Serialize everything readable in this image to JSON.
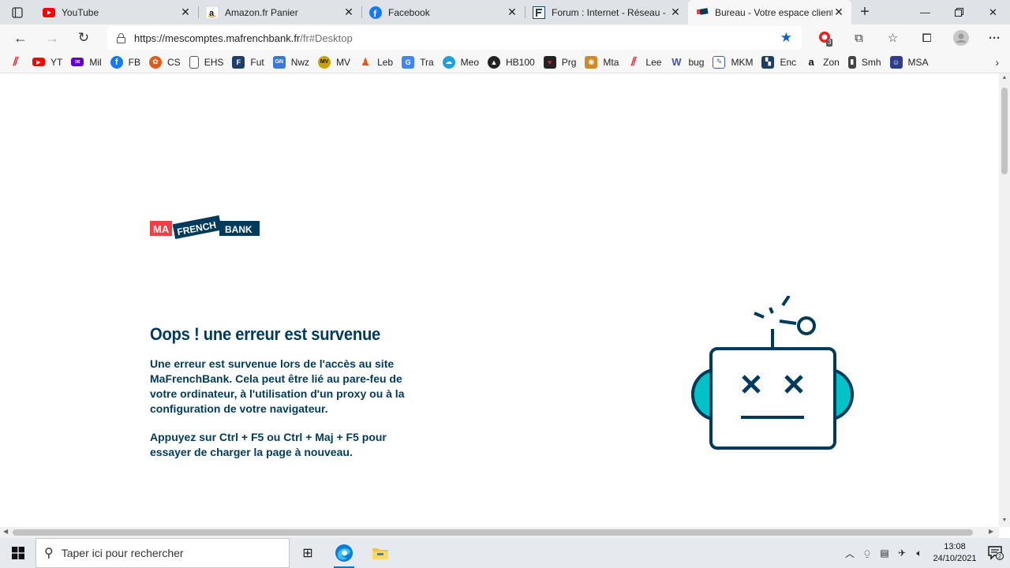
{
  "browser": {
    "tabs": [
      {
        "title": "YouTube",
        "icon": "youtube-icon",
        "active": false
      },
      {
        "title": "Amazon.fr Panier",
        "icon": "amazon-icon",
        "active": false
      },
      {
        "title": "Facebook",
        "icon": "facebook-icon",
        "active": false
      },
      {
        "title": "Forum : Internet - Réseau - Sé",
        "icon": "forum-icon",
        "active": false
      },
      {
        "title": "Bureau - Votre espace client",
        "icon": "mafrenchbank-icon",
        "active": true
      }
    ],
    "address": {
      "url_host": "https://mescomptes.mafrenchbank.fr",
      "url_path": "/fr#Desktop"
    },
    "extension_badge": "3",
    "bookmarks": [
      {
        "label": "",
        "icon": "red-stripes-icon",
        "color": "#e52222"
      },
      {
        "label": "YT",
        "icon": "youtube-icon",
        "color": "#ff0000"
      },
      {
        "label": "Mil",
        "icon": "mail-icon",
        "color": "#6001d2"
      },
      {
        "label": "FB",
        "icon": "facebook-icon",
        "color": "#1877f2"
      },
      {
        "label": "CS",
        "icon": "cs-icon",
        "color": "#e05a1c"
      },
      {
        "label": "EHS",
        "icon": "page-icon",
        "color": "#ffffff"
      },
      {
        "label": "Fut",
        "icon": "futura-icon",
        "color": "#1d3e66"
      },
      {
        "label": "Nwz",
        "icon": "news-icon",
        "color": "#3c78d8"
      },
      {
        "label": "MV",
        "icon": "mv-icon",
        "color": "#c9a400"
      },
      {
        "label": "Leb",
        "icon": "leb-icon",
        "color": "#e8541b"
      },
      {
        "label": "Tra",
        "icon": "translate-icon",
        "color": "#4285f4"
      },
      {
        "label": "Meo",
        "icon": "meteo-icon",
        "color": "#1fa0d8"
      },
      {
        "label": "HB100",
        "icon": "hb100-icon",
        "color": "#222222"
      },
      {
        "label": "Prg",
        "icon": "prg-icon",
        "color": "#b8001f"
      },
      {
        "label": "Mta",
        "icon": "mta-icon",
        "color": "#d08a2a"
      },
      {
        "label": "Lee",
        "icon": "lee-icon",
        "color": "#e52222"
      },
      {
        "label": "bug",
        "icon": "w-icon",
        "color": "#4054b2"
      },
      {
        "label": "MKM",
        "icon": "mkm-icon",
        "color": "#3e5fb0"
      },
      {
        "label": "Enc",
        "icon": "enc-icon",
        "color": "#1d3e66"
      },
      {
        "label": "Zon",
        "icon": "amazon-icon",
        "color": "#222222"
      },
      {
        "label": "Smh",
        "icon": "smh-icon",
        "color": "#444444"
      },
      {
        "label": "MSA",
        "icon": "msa-icon",
        "color": "#2c3e8c"
      }
    ]
  },
  "page": {
    "logo": {
      "ma": "MA",
      "french": "FRENCH",
      "bank": "BANK"
    },
    "error_title": "Oops ! une erreur est survenue",
    "error_text": "Une erreur est survenue lors de l'accès au site MaFrenchBank. Cela peut être lié au pare-feu de votre ordinateur, à l'utilisation d'un proxy ou à la configuration de votre navigateur.",
    "error_hint": "Appuyez sur Ctrl + F5 ou Ctrl + Maj + F5 pour essayer de charger la page à nouveau.",
    "colors": {
      "navy": "#003b5c",
      "teal": "#00c2c7",
      "red": "#ef4044"
    }
  },
  "taskbar": {
    "search_placeholder": "Taper ici pour rechercher",
    "time": "13:08",
    "date": "24/10/2021",
    "notifications_count": "2"
  }
}
